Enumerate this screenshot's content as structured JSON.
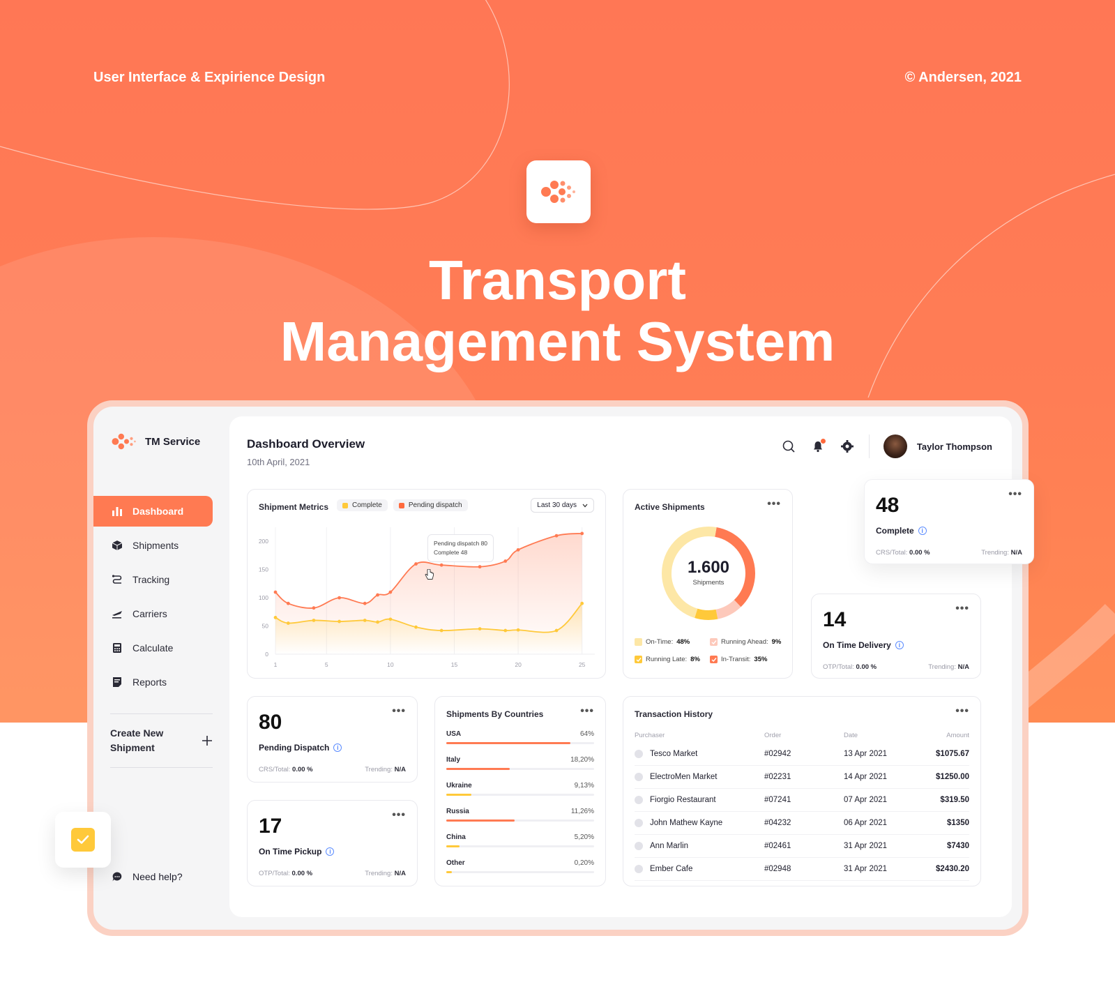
{
  "hero": {
    "tagline": "User Interface & Expirience Design",
    "copyright": "© Andersen, 2021",
    "title_line1": "Transport",
    "title_line2": "Management System"
  },
  "colors": {
    "accent": "#ff7a52",
    "yellow": "#ffc93a",
    "pale_yellow": "#fde7a6",
    "pale_orange": "#fdb9a5"
  },
  "sidebar": {
    "brand": "TM Service",
    "items": [
      {
        "label": "Dashboard",
        "icon": "bar-chart-icon"
      },
      {
        "label": "Shipments",
        "icon": "box-icon"
      },
      {
        "label": "Tracking",
        "icon": "route-icon"
      },
      {
        "label": "Carriers",
        "icon": "plane-icon"
      },
      {
        "label": "Calculate",
        "icon": "calculator-icon"
      },
      {
        "label": "Reports",
        "icon": "report-icon"
      }
    ],
    "create_line1": "Create New",
    "create_line2": "Shipment",
    "help": "Need help?"
  },
  "header": {
    "title": "Dashboard Overview",
    "date": "10th April, 2021",
    "user": "Taylor Thompson"
  },
  "metrics_card": {
    "title": "Shipment Metrics",
    "legend_complete": "Complete",
    "legend_pending": "Pending dispatch",
    "range": "Last 30 days",
    "tooltip_pending": "Pending dispatch 80",
    "tooltip_complete": "Complete 48"
  },
  "chart_data": {
    "type": "area",
    "x": [
      1,
      2,
      4,
      6,
      8,
      9,
      10,
      12,
      14,
      17,
      19,
      20,
      23,
      25
    ],
    "xticks": [
      1,
      5,
      10,
      15,
      20,
      25
    ],
    "yticks": [
      0,
      50,
      100,
      150,
      200
    ],
    "ylim": [
      0,
      225
    ],
    "xlim": [
      1,
      26
    ],
    "series": [
      {
        "name": "Pending dispatch",
        "color": "#ff7a52",
        "values": [
          110,
          90,
          82,
          100,
          90,
          105,
          110,
          160,
          158,
          155,
          165,
          185,
          210,
          214
        ]
      },
      {
        "name": "Complete",
        "color": "#ffc93a",
        "values": [
          65,
          55,
          60,
          58,
          60,
          57,
          62,
          48,
          42,
          45,
          42,
          43,
          42,
          90
        ]
      }
    ]
  },
  "active_shipments": {
    "title": "Active Shipments",
    "total": "1.600",
    "total_label": "Shipments",
    "legend": [
      {
        "label": "On-Time:",
        "value": "48%",
        "color": "#fde7a6"
      },
      {
        "label": "Running Ahead:",
        "value": "9%",
        "color": "#fdc9bb"
      },
      {
        "label": "Running Late:",
        "value": "8%",
        "color": "#ffc93a"
      },
      {
        "label": "In-Transit:",
        "value": "35%",
        "color": "#ff7a52"
      }
    ]
  },
  "kpis": {
    "complete": {
      "value": "48",
      "label": "Complete",
      "foot_left": "CRS/Total:",
      "foot_left_val": "0.00 %",
      "foot_right": "Trending:",
      "foot_right_val": "N/A"
    },
    "on_time_delivery": {
      "value": "14",
      "label": "On Time Delivery",
      "foot_left": "OTP/Total:",
      "foot_left_val": "0.00 %",
      "foot_right": "Trending:",
      "foot_right_val": "N/A"
    },
    "pending_dispatch": {
      "value": "80",
      "label": "Pending Dispatch",
      "foot_left": "CRS/Total:",
      "foot_left_val": "0.00 %",
      "foot_right": "Trending:",
      "foot_right_val": "N/A"
    },
    "on_time_pickup": {
      "value": "17",
      "label": "On Time Pickup",
      "foot_left": "OTP/Total:",
      "foot_left_val": "0.00 %",
      "foot_right": "Trending:",
      "foot_right_val": "N/A"
    }
  },
  "countries": {
    "title": "Shipments By Countries",
    "rows": [
      {
        "name": "USA",
        "pct": "64%",
        "fraction": 0.84,
        "color": "#ff7a52"
      },
      {
        "name": "Italy",
        "pct": "18,20%",
        "fraction": 0.43,
        "color": "#ff7a52"
      },
      {
        "name": "Ukraine",
        "pct": "9,13%",
        "fraction": 0.17,
        "color": "#ffc93a"
      },
      {
        "name": "Russia",
        "pct": "11,26%",
        "fraction": 0.46,
        "color": "#ff7a52"
      },
      {
        "name": "China",
        "pct": "5,20%",
        "fraction": 0.09,
        "color": "#ffc93a"
      },
      {
        "name": "Other",
        "pct": "0,20%",
        "fraction": 0.04,
        "color": "#ffc93a"
      }
    ]
  },
  "transactions": {
    "title": "Transaction History",
    "headers": {
      "purchaser": "Purchaser",
      "order": "Order",
      "date": "Date",
      "amount": "Amount"
    },
    "rows": [
      {
        "purchaser": "Tesco Market",
        "order": "#02942",
        "date": "13 Apr 2021",
        "amount": "$1075.67"
      },
      {
        "purchaser": "ElectroMen Market",
        "order": "#02231",
        "date": "14 Apr 2021",
        "amount": "$1250.00"
      },
      {
        "purchaser": "Fiorgio Restaurant",
        "order": "#07241",
        "date": "07 Apr 2021",
        "amount": "$319.50"
      },
      {
        "purchaser": "John Mathew Kayne",
        "order": "#04232",
        "date": "06 Apr 2021",
        "amount": "$1350"
      },
      {
        "purchaser": "Ann Marlin",
        "order": "#02461",
        "date": "31 Apr 2021",
        "amount": "$7430"
      },
      {
        "purchaser": "Ember Cafe",
        "order": "#02948",
        "date": "31 Apr 2021",
        "amount": "$2430.20"
      }
    ]
  }
}
